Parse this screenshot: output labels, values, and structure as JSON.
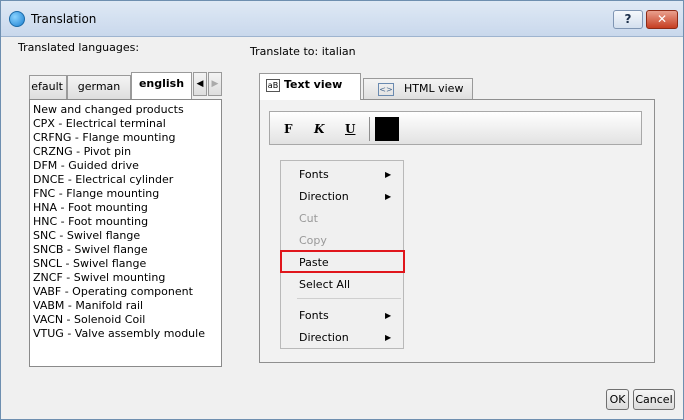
{
  "window": {
    "title": "Translation",
    "help_label": "?",
    "close_label": "✕"
  },
  "left": {
    "label": "Translated languages:",
    "tabs": [
      {
        "label": "efault"
      },
      {
        "label": "german"
      },
      {
        "label": "english"
      }
    ],
    "scroll_left": "◀",
    "scroll_right": "▶",
    "items": [
      "New and changed products",
      "CPX - Electrical terminal",
      "CRFNG - Flange mounting",
      "CRZNG - Pivot pin",
      "DFM - Guided drive",
      "DNCE - Electrical cylinder",
      "FNC - Flange mounting",
      "HNA - Foot mounting",
      "HNC - Foot mounting",
      "SNC - Swivel flange",
      "SNCB - Swivel flange",
      "SNCL - Swivel flange",
      "ZNCF - Swivel mounting",
      "VABF - Operating component",
      "VABM - Manifold rail",
      "VACN - Solenoid Coil",
      "VTUG - Valve assembly module"
    ]
  },
  "right": {
    "label": "Translate to: italian",
    "tabs": [
      {
        "label": "Text view",
        "icon": "aB"
      },
      {
        "label": "HTML view",
        "icon": "<>"
      }
    ],
    "toolbar": {
      "bold": "F",
      "italic": "K",
      "underline": "U",
      "color": "#000000"
    }
  },
  "context_menu": {
    "fonts_1": "Fonts",
    "direction_1": "Direction",
    "cut": "Cut",
    "copy": "Copy",
    "paste": "Paste",
    "select_all": "Select All",
    "fonts_2": "Fonts",
    "direction_2": "Direction",
    "arrow": "▶"
  },
  "buttons": {
    "ok": "OK",
    "cancel": "Cancel"
  },
  "colors": {
    "highlight": "#e0161c",
    "titlebar": "#c9d8ec"
  }
}
